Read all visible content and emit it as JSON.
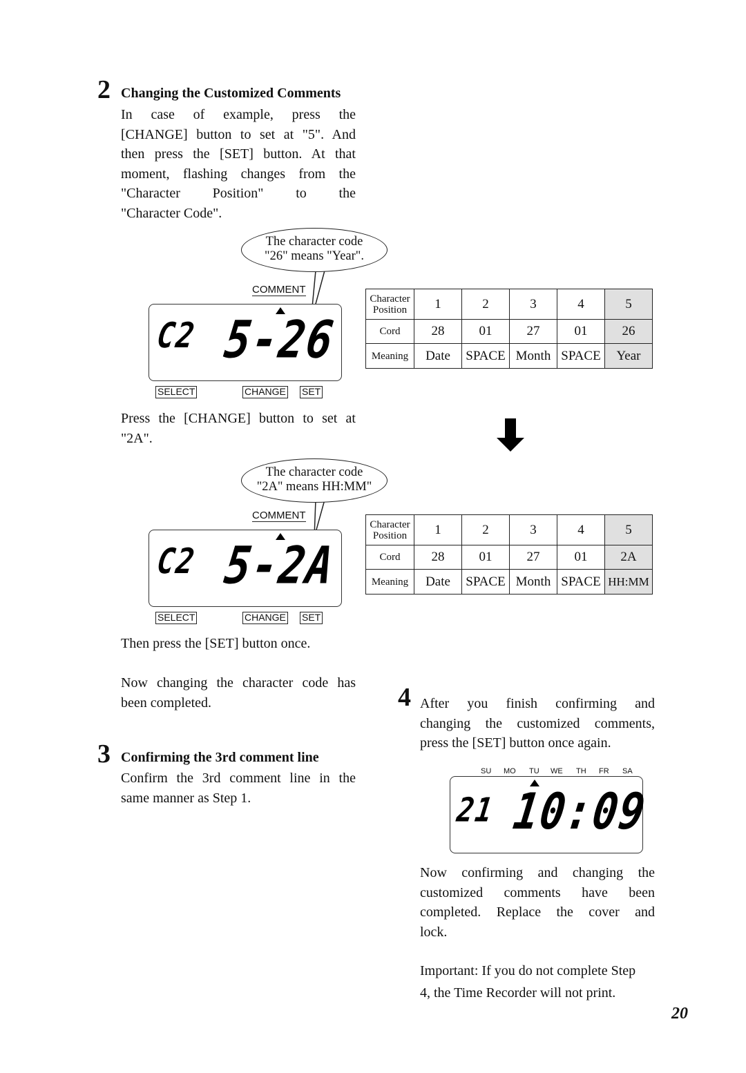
{
  "step2": {
    "number": "2",
    "title": "Changing the Customized Comments",
    "lines": [
      "In case of example, press the",
      "[CHANGE] button to set at \"5\". And",
      "then press the [SET] button. At that",
      "moment, flashing changes from the",
      "\"Character Position\" to the",
      "\"Character Code\"."
    ]
  },
  "fig1": {
    "bubble1": "The character code",
    "bubble2": "\"26\" means \"Year\".",
    "comment_label": "COMMENT",
    "lcd_left": "C2",
    "lcd_right": "5-26",
    "buttons": [
      "SELECT",
      "CHANGE",
      "SET"
    ]
  },
  "table1": {
    "headers": [
      "Character Position",
      "Cord",
      "Meaning"
    ],
    "positions": [
      "1",
      "2",
      "3",
      "4",
      "5"
    ],
    "codes": [
      "28",
      "01",
      "27",
      "01",
      "26"
    ],
    "meanings": [
      "Date",
      "SPACE",
      "Month",
      "SPACE",
      "Year"
    ]
  },
  "press_change": [
    "Press the [CHANGE] button to set at",
    "\"2A\"."
  ],
  "fig2": {
    "bubble1": "The character code",
    "bubble2": "\"2A\" means HH:MM\"",
    "comment_label": "COMMENT",
    "lcd_left": "C2",
    "lcd_right": "5-2A",
    "buttons": [
      "SELECT",
      "CHANGE",
      "SET"
    ]
  },
  "table2": {
    "headers": [
      "Character Position",
      "Cord",
      "Meaning"
    ],
    "positions": [
      "1",
      "2",
      "3",
      "4",
      "5"
    ],
    "codes": [
      "28",
      "01",
      "27",
      "01",
      "2A"
    ],
    "meanings": [
      "Date",
      "SPACE",
      "Month",
      "SPACE",
      "HH:MM"
    ]
  },
  "then_press": "Then press the [SET] button once.",
  "now_changing": [
    "Now changing the character code has",
    "been completed."
  ],
  "step3": {
    "number": "3",
    "title": "Confirming the 3rd comment line",
    "lines": [
      "Confirm the 3rd comment line in the",
      "same manner as Step 1."
    ]
  },
  "step4": {
    "number": "4",
    "lines": [
      "After you finish confirming and",
      "changing the customized comments,",
      "press the [SET] button once again."
    ]
  },
  "fig3": {
    "days": [
      "SU",
      "MO",
      "TU",
      "WE",
      "TH",
      "FR",
      "SA"
    ],
    "selected_day": "TU",
    "lcd_left": "21",
    "lcd_right": "10:09"
  },
  "now_confirming": [
    "Now confirming and changing the",
    "customized comments have been",
    "completed. Replace the cover and",
    "lock."
  ],
  "important": [
    "Important: If you do not complete Step",
    "4, the Time Recorder will  not print."
  ],
  "page_number": "20"
}
